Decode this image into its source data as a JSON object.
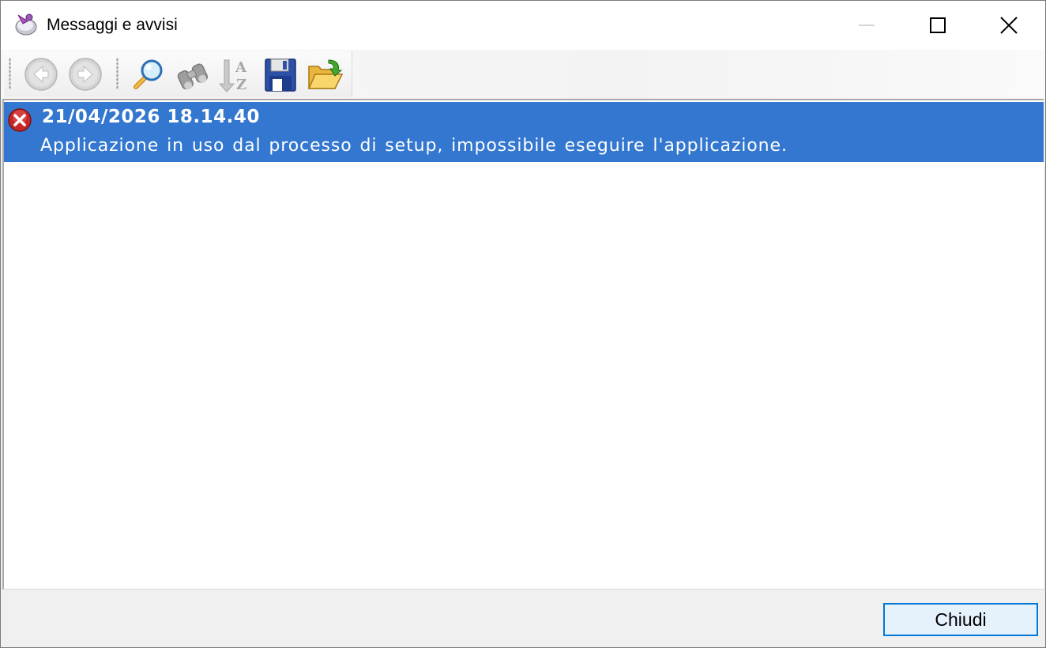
{
  "window": {
    "title": "Messaggi e avvisi",
    "app_icon": "app-logo-icon",
    "controls": [
      "minimize-icon",
      "maximize-icon",
      "close-icon"
    ]
  },
  "toolbar": {
    "items": [
      {
        "name": "back",
        "icon": "back-arrow-icon",
        "enabled": false
      },
      {
        "name": "forward",
        "icon": "forward-arrow-icon",
        "enabled": false
      },
      {
        "name": "search",
        "icon": "magnifier-icon",
        "enabled": true
      },
      {
        "name": "find",
        "icon": "binoculars-icon",
        "enabled": false
      },
      {
        "name": "sort",
        "icon": "sort-az-icon",
        "enabled": false
      },
      {
        "name": "save",
        "icon": "floppy-disk-icon",
        "enabled": true
      },
      {
        "name": "open",
        "icon": "open-folder-icon",
        "enabled": true
      }
    ]
  },
  "messages": [
    {
      "type": "error",
      "icon": "error-icon",
      "timestamp": "21/04/2026 18.14.40",
      "text": "Applicazione in uso dal processo di setup, impossibile eseguire l'applicazione.",
      "selected": true
    }
  ],
  "footer": {
    "close_label": "Chiudi"
  },
  "colors": {
    "selection": "#3377d0",
    "button_focus_border": "#0078d7",
    "button_background": "#e5f1fb",
    "error": "#c62828"
  }
}
